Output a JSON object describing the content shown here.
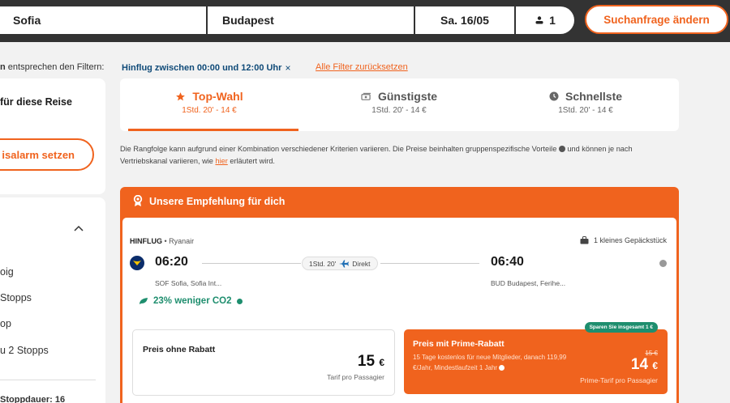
{
  "search": {
    "from": "Sofia",
    "to": "Budapest",
    "date": "Sa. 16/05",
    "passengers": "1",
    "change_button": "Suchanfrage ändern"
  },
  "filters": {
    "match_prefix": "n",
    "match_suffix": " entsprechen den Filtern:",
    "active_filter": "Hinflug zwischen 00:00 und 12:00 Uhr",
    "remove_symbol": "×",
    "reset_all": "Alle Filter zurücksetzen"
  },
  "sidebar": {
    "alert_text": "für diese Reise",
    "alert_button": "isalarm setzen",
    "stops_options": [
      "oig",
      "Stopps",
      "op",
      "u 2 Stopps"
    ],
    "duration_label": "Stoppdauer: 16"
  },
  "sort_tabs": [
    {
      "label": "Top-Wahl",
      "sub": "1Std. 20' - 14 €",
      "icon": "star-icon",
      "active": true
    },
    {
      "label": "Günstigste",
      "sub": "1Std. 20' - 14 €",
      "icon": "money-icon",
      "active": false
    },
    {
      "label": "Schnellste",
      "sub": "1Std. 20' - 14 €",
      "icon": "clock-icon",
      "active": false
    }
  ],
  "disclaimer": {
    "part1": "Die Rangfolge kann aufgrund einer Kombination verschiedener Kriterien variieren. Die Preise beinhalten gruppenspezifische Vorteile ",
    "part2": " und können je nach Vertriebskanal variieren, wie ",
    "link": "hier",
    "part3": " erläutert wird."
  },
  "recommendation": {
    "title": "Unsere Empfehlung für dich",
    "leg": "HINFLUG",
    "airline": " • Ryanair",
    "baggage": "1 kleines Gepäckstück",
    "dep_time": "06:20",
    "arr_time": "06:40",
    "duration": "1Std. 20'",
    "stops": "Direkt",
    "dep_airport": "SOF Sofia, Sofia Int...",
    "arr_airport": "BUD Budapest, Ferihe...",
    "co2": "23% weniger CO2",
    "price_plain": {
      "title": "Preis ohne Rabatt",
      "amount": "15",
      "currency": "€",
      "sub": "Tarif pro Passagier"
    },
    "price_prime": {
      "badge": "Sparen Sie insgesamt 1 €",
      "title": "Preis mit Prime-Rabatt",
      "desc": "15 Tage kostenlos für neue Mitglieder, danach 119,99 €/Jahr, Mindestlaufzeit 1 Jahr ",
      "old": "15 €",
      "amount": "14",
      "currency": "€",
      "sub": "Prime-Tarif pro Passagier"
    }
  },
  "colors": {
    "accent": "#f0631e",
    "green": "#1e8e6e",
    "navy": "#0f4a78",
    "topbar": "#333333"
  }
}
